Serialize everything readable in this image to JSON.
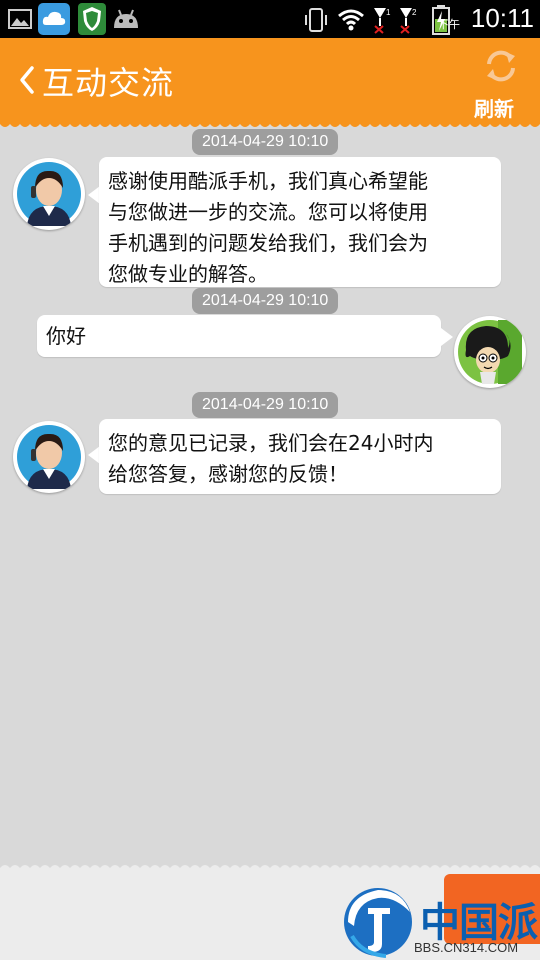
{
  "status_bar": {
    "time": "10:11",
    "ampm": "下午",
    "icons": [
      "gallery-icon",
      "cloud-icon",
      "shield-icon",
      "android-icon",
      "vibrate-icon",
      "wifi-icon",
      "signal-1-icon",
      "signal-2-icon",
      "battery-charging-icon"
    ]
  },
  "header": {
    "title": "互动交流",
    "refresh_label": "刷新",
    "background_color": "#f7941d"
  },
  "messages": [
    {
      "timestamp": "2014-04-29 10:10",
      "side": "left",
      "sender": "service-agent",
      "lines": [
        "感谢使用酷派手机，我们真心希望能",
        "与您做进一步的交流。您可以将使用",
        "手机遇到的问题发给我们，我们会为",
        "您做专业的解答。"
      ]
    },
    {
      "timestamp": "2014-04-29 10:10",
      "side": "right",
      "sender": "user",
      "lines": [
        "你好"
      ]
    },
    {
      "timestamp": "2014-04-29 10:10",
      "side": "left",
      "sender": "service-agent",
      "lines": [
        "您的意见已记录，我们会在24小时内",
        "给您答复，感谢您的反馈！"
      ]
    }
  ],
  "footer": {
    "logo_text": "中国派",
    "logo_url": "BBS.CN314.COM"
  }
}
